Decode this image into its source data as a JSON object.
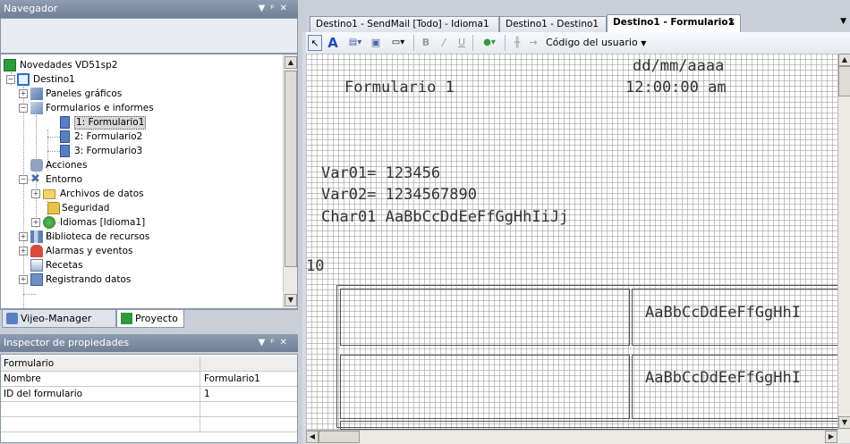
{
  "navigator": {
    "title": "Navegador",
    "tree": [
      {
        "label": "Novedades VD51sp2",
        "icon": "project-icon"
      },
      {
        "label": "Destino1",
        "icon": "target-icon"
      },
      {
        "label": "Paneles gráficos",
        "icon": "panels-icon"
      },
      {
        "label": "Formularios e informes",
        "icon": "forms-icon"
      },
      {
        "label": "1: Formulario1",
        "icon": "document-icon"
      },
      {
        "label": "2: Formulario2",
        "icon": "document-icon"
      },
      {
        "label": "3: Formulario3",
        "icon": "document-icon"
      },
      {
        "label": "Acciones",
        "icon": "actions-icon"
      },
      {
        "label": "Entorno",
        "icon": "environment-icon"
      },
      {
        "label": "Archivos de datos",
        "icon": "folder-icon"
      },
      {
        "label": "Seguridad",
        "icon": "lock-icon"
      },
      {
        "label": "Idiomas [Idioma1]",
        "icon": "language-icon"
      },
      {
        "label": "Biblioteca de recursos",
        "icon": "library-icon"
      },
      {
        "label": "Alarmas y eventos",
        "icon": "alarm-icon"
      },
      {
        "label": "Recetas",
        "icon": "recipe-icon"
      },
      {
        "label": "Registrando datos",
        "icon": "logging-icon"
      }
    ],
    "tabs": [
      "Vijeo-Manager",
      "Proyecto"
    ]
  },
  "inspector": {
    "title": "Inspector de propiedades",
    "header": "Formulario",
    "rows": [
      {
        "name": "Nombre",
        "value": "Formulario1"
      },
      {
        "name": "ID del formulario",
        "value": "1"
      }
    ]
  },
  "editor": {
    "tabs": [
      "Destino1 - SendMail [Todo] - Idioma1",
      "Destino1 - Destino1",
      "Destino1 - Formulario1"
    ],
    "toolbar": {
      "user_code": "Código del usuario"
    },
    "form": {
      "date": "dd/mm/aaaa",
      "title": "Formulario 1",
      "time": "12:00:00 am",
      "var01": "Var01= 123456",
      "var02": "Var02= 1234567890",
      "char01": "Char01 AaBbCcDdEeFfGgHhIiJj",
      "num": "10",
      "cell1": "AaBbCcDdEeFfGgHhI",
      "cell2": "AaBbCcDdEeFfGgHhI"
    }
  },
  "colors": {
    "panel_title": "#7f8ea4",
    "accent_green": "#2e9a3a",
    "selection": "#d8d8d8"
  }
}
